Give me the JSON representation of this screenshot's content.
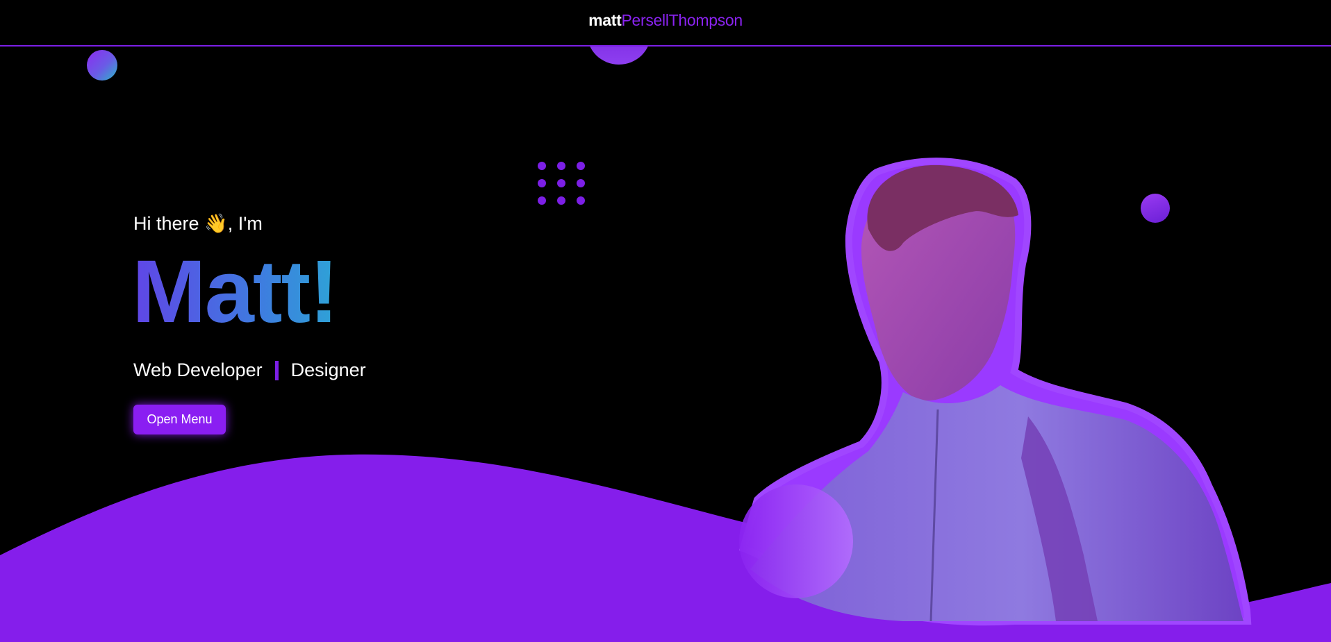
{
  "header": {
    "logo_part_1": "matt",
    "logo_part_2": "PersellThompson"
  },
  "hero": {
    "greeting_prefix": "Hi there",
    "greeting_emoji": "👋",
    "greeting_suffix": ", I'm",
    "name": "Matt!",
    "role_1": "Web Developer",
    "role_2": "Designer",
    "button_label": "Open Menu"
  },
  "colors": {
    "accent": "#8a1ef2",
    "wave": "#851eeb",
    "background": "#000000"
  },
  "icons": {
    "wave_emoji": "waving-hand-icon"
  }
}
